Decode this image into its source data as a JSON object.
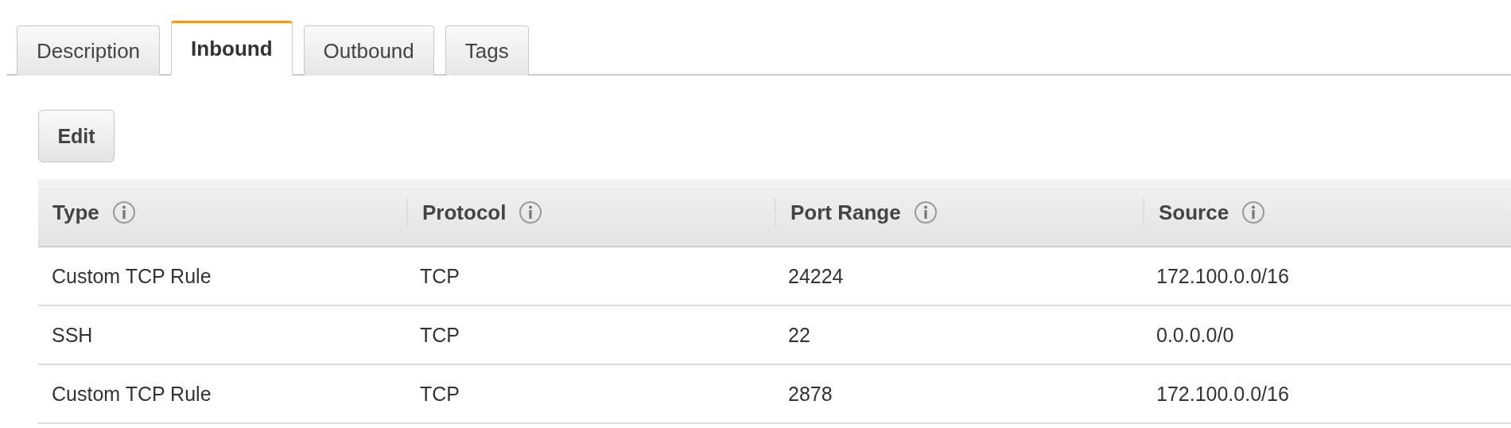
{
  "tabs": [
    {
      "label": "Description",
      "selected": false
    },
    {
      "label": "Inbound",
      "selected": true
    },
    {
      "label": "Outbound",
      "selected": false
    },
    {
      "label": "Tags",
      "selected": false
    }
  ],
  "edit_button": {
    "label": "Edit"
  },
  "table": {
    "columns": [
      "Type",
      "Protocol",
      "Port Range",
      "Source"
    ],
    "rows": [
      [
        "Custom TCP Rule",
        "TCP",
        "24224",
        "172.100.0.0/16"
      ],
      [
        "SSH",
        "TCP",
        "22",
        "0.0.0.0/0"
      ],
      [
        "Custom TCP Rule",
        "TCP",
        "2878",
        "172.100.0.0/16"
      ]
    ]
  }
}
